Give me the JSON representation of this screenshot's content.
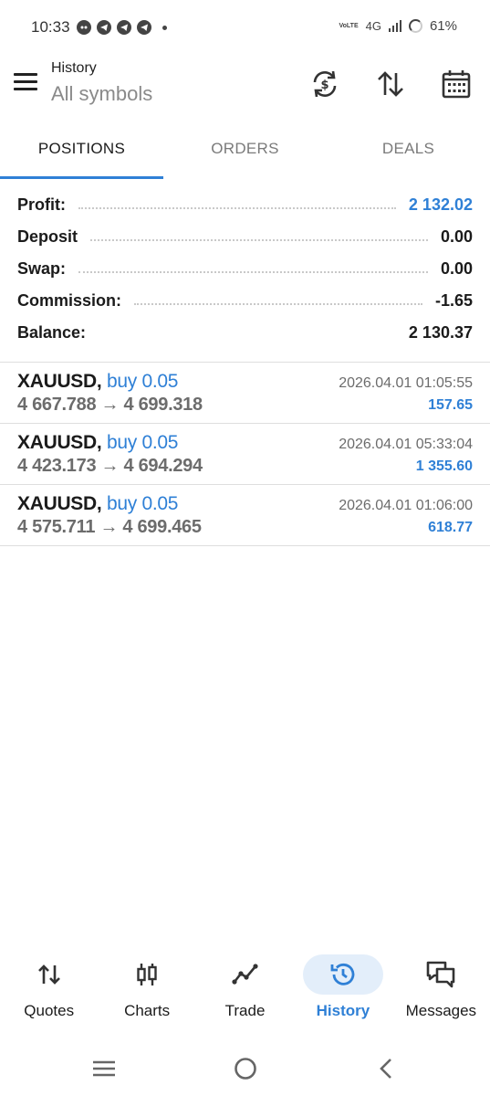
{
  "status_bar": {
    "time": "10:33",
    "network_small": "VoLTE",
    "network": "4G",
    "battery": "61%"
  },
  "header": {
    "title": "History",
    "subtitle": "All symbols"
  },
  "tabs": [
    {
      "label": "POSITIONS",
      "active": true
    },
    {
      "label": "ORDERS",
      "active": false
    },
    {
      "label": "DEALS",
      "active": false
    }
  ],
  "summary": [
    {
      "label": "Profit:",
      "value": "2 132.02",
      "color": "#2f80d6"
    },
    {
      "label": "Deposit",
      "value": "0.00"
    },
    {
      "label": "Swap:",
      "value": "0.00"
    },
    {
      "label": "Commission:",
      "value": "-1.65"
    },
    {
      "label": "Balance:",
      "value": "2 130.37"
    }
  ],
  "positions": [
    {
      "symbol": "XAUUSD",
      "type": "buy 0.05",
      "open_price": "4 667.788",
      "arrow": "→",
      "close_price": "4 699.318",
      "time": "2026.04.01 01:05:55",
      "profit": "157.65"
    },
    {
      "symbol": "XAUUSD",
      "type": "buy 0.05",
      "open_price": "4 423.173",
      "arrow": "→",
      "close_price": "4 694.294",
      "time": "2026.04.01 05:33:04",
      "profit": "1 355.60"
    },
    {
      "symbol": "XAUUSD",
      "type": "buy 0.05",
      "open_price": "4 575.711",
      "arrow": "→",
      "close_price": "4 699.465",
      "time": "2026.04.01 01:06:00",
      "profit": "618.77"
    }
  ],
  "bottom_nav": [
    {
      "label": "Quotes",
      "icon": "quotes-arrows-icon",
      "active": false
    },
    {
      "label": "Charts",
      "icon": "candlestick-icon",
      "active": false
    },
    {
      "label": "Trade",
      "icon": "trade-line-icon",
      "active": false
    },
    {
      "label": "History",
      "icon": "history-clock-icon",
      "active": true
    },
    {
      "label": "Messages",
      "icon": "messages-icon",
      "active": false
    }
  ],
  "colors": {
    "accent": "#2f80d6",
    "active_nav_bg": "#e3eefa",
    "muted": "#6c6c6c"
  }
}
